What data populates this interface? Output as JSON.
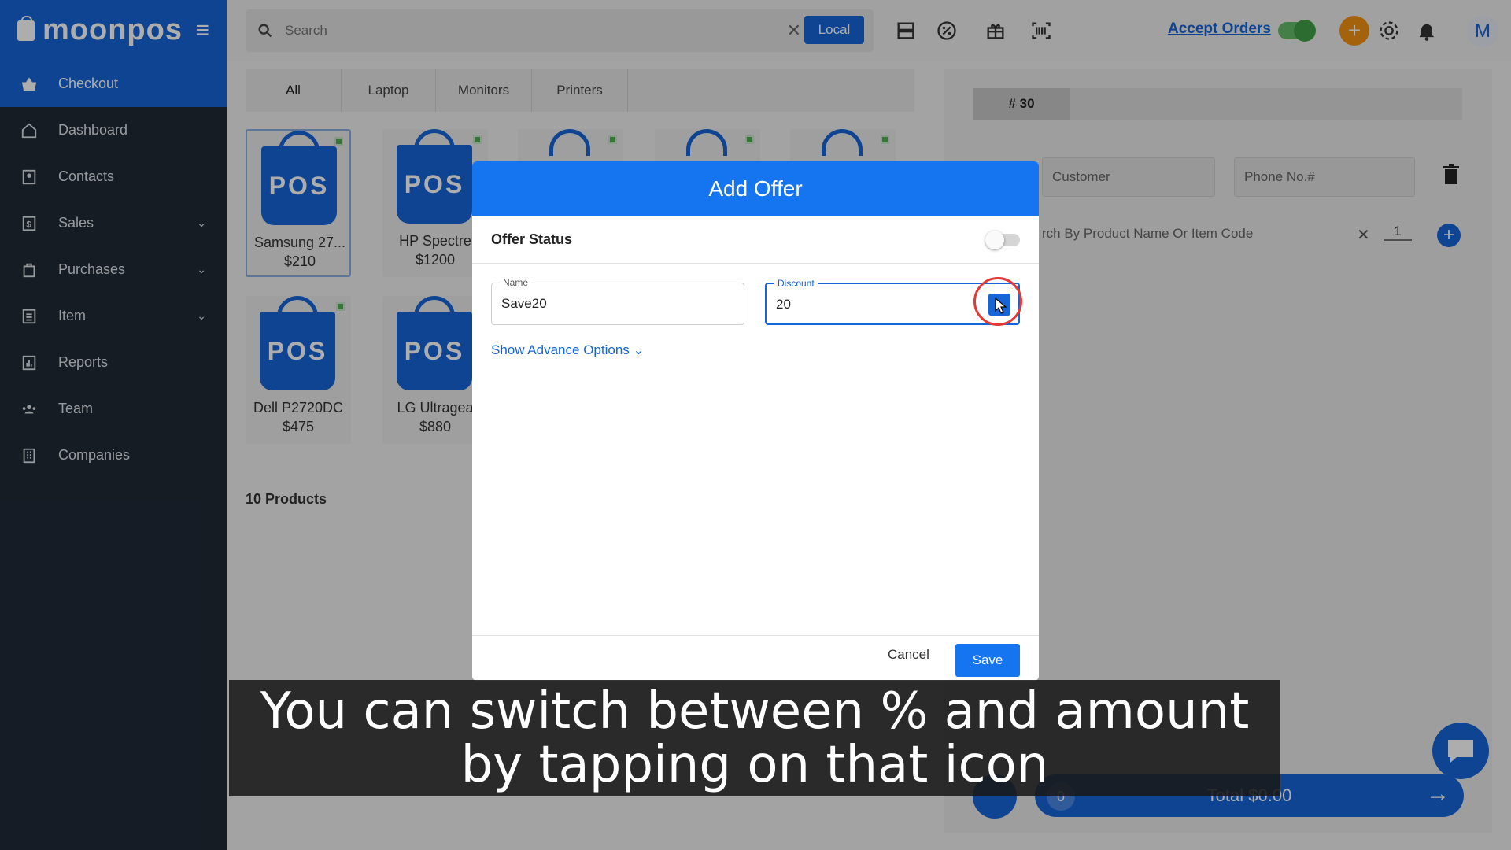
{
  "app": {
    "brand": "moonpos"
  },
  "sidebar": {
    "items": [
      {
        "label": "Checkout"
      },
      {
        "label": "Dashboard"
      },
      {
        "label": "Contacts"
      },
      {
        "label": "Sales"
      },
      {
        "label": "Purchases"
      },
      {
        "label": "Item"
      },
      {
        "label": "Reports"
      },
      {
        "label": "Team"
      },
      {
        "label": "Companies"
      }
    ]
  },
  "topbar": {
    "search_placeholder": "Search",
    "qty": "1",
    "local_label": "Local",
    "accept_orders": "Accept Orders",
    "avatar_initial": "M"
  },
  "categories": [
    {
      "label": "All"
    },
    {
      "label": "Laptop"
    },
    {
      "label": "Monitors"
    },
    {
      "label": "Printers"
    }
  ],
  "products": [
    {
      "name": "Samsung 27...",
      "price": "$210",
      "logo": "POS"
    },
    {
      "name": "HP Spectre",
      "price": "$1200",
      "logo": "POS"
    },
    {
      "name": "Dell P2720DC",
      "price": "$475",
      "logo": "POS"
    },
    {
      "name": "LG Ultragea",
      "price": "$880",
      "logo": "POS"
    }
  ],
  "product_count": "10 Products",
  "order": {
    "number": "# 30",
    "customer_placeholder": "Customer",
    "phone_placeholder": "Phone No.#",
    "product_search_placeholder": "rch By Product Name Or Item Code",
    "qty": "1",
    "count": "0",
    "total": "Total $0.00"
  },
  "modal": {
    "title": "Add Offer",
    "status_label": "Offer Status",
    "name_label": "Name",
    "name_value": "Save20",
    "discount_label": "Discount",
    "discount_value": "20",
    "advance_link": "Show Advance Options",
    "cancel_label": "Cancel",
    "save_label": "Save"
  },
  "caption": {
    "line1": "You can switch between % and amount",
    "line2": "by tapping on that icon"
  },
  "colors": {
    "primary": "#1565d8",
    "sidebar": "#1f2a36",
    "accent_orange": "#f29113",
    "toggle_green": "#43a047",
    "highlight_red": "#e53935"
  }
}
